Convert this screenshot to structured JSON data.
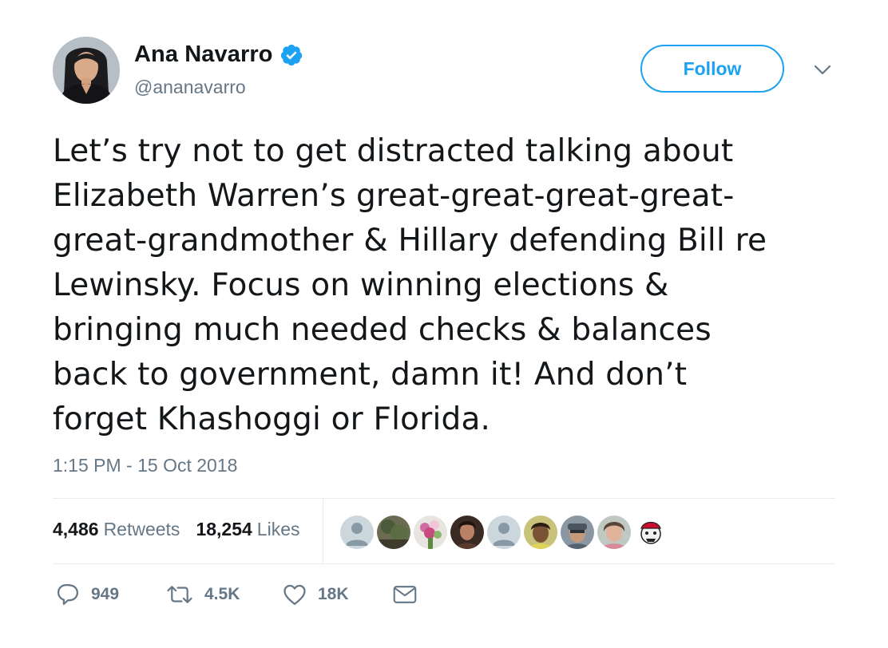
{
  "user": {
    "name": "Ana Navarro",
    "handle": "@ananavarro",
    "verified": true
  },
  "follow_button": {
    "label": "Follow"
  },
  "tweet": {
    "text": "Let’s try not to get distracted talking about\nElizabeth Warren’s great-great-great-great-\ngreat-grandmother & Hillary defending Bill re\nLewinsky. Focus on winning elections &\nbringing much needed checks & balances\nback to government, damn it! And don’t\nforget Khashoggi or Florida.",
    "timestamp": "1:15 PM - 15 Oct 2018"
  },
  "stats": {
    "retweets_count": "4,486",
    "retweets_label": "Retweets",
    "likes_count": "18,254",
    "likes_label": "Likes"
  },
  "actions": {
    "reply_count": "949",
    "retweet_count": "4.5K",
    "like_count": "18K"
  },
  "colors": {
    "accent": "#1da1f2",
    "secondary_text": "#657786",
    "divider": "#e6ecf0"
  }
}
